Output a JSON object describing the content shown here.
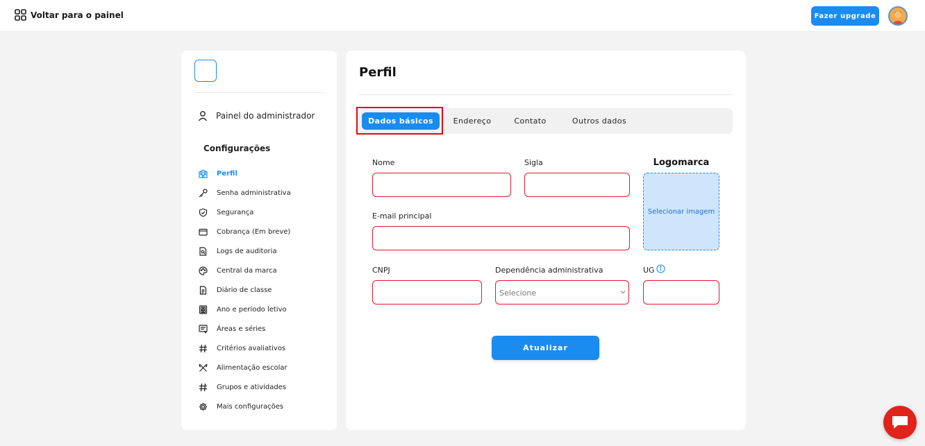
{
  "topbar": {
    "back_label": "Voltar para o painel",
    "upgrade_label": "Fazer upgrade"
  },
  "sidebar": {
    "admin_label": "Painel do administrador",
    "section_title": "Configurações",
    "items": [
      {
        "label": "Perfil",
        "icon": "building-icon",
        "active": true
      },
      {
        "label": "Senha administrativa",
        "icon": "key-icon"
      },
      {
        "label": "Segurança",
        "icon": "shield-icon"
      },
      {
        "label": "Cobrança (Em breve)",
        "icon": "card-icon"
      },
      {
        "label": "Logs de auditoria",
        "icon": "file-search-icon"
      },
      {
        "label": "Central da marca",
        "icon": "palette-icon"
      },
      {
        "label": "Diário de classe",
        "icon": "document-icon"
      },
      {
        "label": "Ano e período letivo",
        "icon": "calendar-icon"
      },
      {
        "label": "Áreas e séries",
        "icon": "list-icon"
      },
      {
        "label": "Critérios avaliativos",
        "icon": "hash-icon"
      },
      {
        "label": "Alimentação escolar",
        "icon": "utensils-icon"
      },
      {
        "label": "Grupos e atividades",
        "icon": "hash-icon"
      },
      {
        "label": "Mais configurações",
        "icon": "gear-icon"
      }
    ]
  },
  "main": {
    "title": "Perfil",
    "tabs": [
      {
        "label": "Dados básicos",
        "active": true
      },
      {
        "label": "Endereço"
      },
      {
        "label": "Contato"
      },
      {
        "label": "Outros dados"
      }
    ],
    "form": {
      "nome_label": "Nome",
      "nome_value": "",
      "sigla_label": "Sigla",
      "sigla_value": "",
      "email_label": "E-mail principal",
      "email_value": "",
      "cnpj_label": "CNPJ",
      "cnpj_value": "",
      "dependencia_label": "Dependência administrativa",
      "dependencia_value": "Selecione",
      "ug_label": "UG",
      "ug_value": "",
      "logo_title": "Logomarca",
      "logo_button": "Selecionar imagem",
      "submit_label": "Atualizar"
    }
  },
  "colors": {
    "accent": "#1a8cf0",
    "error": "#e3182d",
    "chat": "#e0231b"
  }
}
